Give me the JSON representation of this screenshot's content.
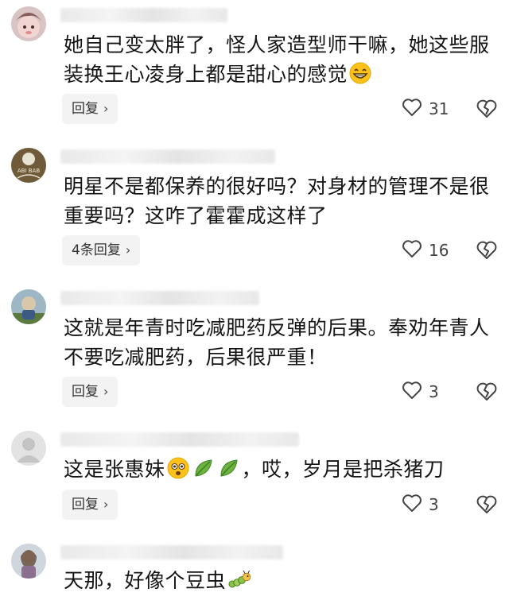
{
  "comments": [
    {
      "text_parts": [
        "她自己变太胖了，怪人家造型师干嘛，她这些服装换王心凌身上都是甜心的感觉"
      ],
      "emojis": [
        "grinning-face-emoji"
      ],
      "reply_label": "回复",
      "likes": "31"
    },
    {
      "text_parts": [
        "明星不是都保养的很好吗？对身材的管理不是很重要吗？这咋了霍霍成这样了"
      ],
      "avatar_text": "ABI BAB",
      "reply_label": "4条回复",
      "likes": "16"
    },
    {
      "text_parts": [
        "这就是年青时吃减肥药反弹的后果。奉劝年青人不要吃减肥药，后果很严重！"
      ],
      "reply_label": "回复",
      "likes": "3"
    },
    {
      "text_parts": [
        "这是张惠妹",
        "，哎，岁月是把杀猪刀"
      ],
      "emojis": [
        "flushed-face-emoji",
        "leaf-emoji",
        "leaf-emoji"
      ],
      "reply_label": "回复",
      "likes": "3"
    },
    {
      "text_parts": [
        "天那，好像个豆虫"
      ],
      "emojis": [
        "caterpillar-emoji"
      ]
    }
  ],
  "icons": {
    "like": "heart-outline-icon",
    "dislike": "broken-heart-outline-icon",
    "chevron": "chevron-right-icon"
  },
  "chevron_glyph": "›"
}
